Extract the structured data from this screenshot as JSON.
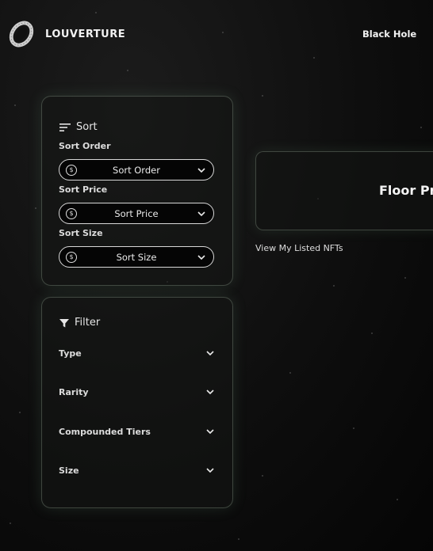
{
  "header": {
    "brand": "LOUVERTURE",
    "nav_link": "Black Hole",
    "logo_icon": "black-hole-ring-logo"
  },
  "sort": {
    "title": "Sort",
    "title_icon": "sort-lines-icon",
    "fields": [
      {
        "label": "Sort Order",
        "value": "Sort Order"
      },
      {
        "label": "Sort Price",
        "value": "Sort Price"
      },
      {
        "label": "Sort Size",
        "value": "Sort Size"
      }
    ],
    "select_icon": "dollar-coin-icon"
  },
  "filter": {
    "title": "Filter",
    "title_icon": "funnel-icon",
    "rows": [
      {
        "label": "Type"
      },
      {
        "label": "Rarity"
      },
      {
        "label": "Compounded Tiers"
      },
      {
        "label": "Size"
      }
    ]
  },
  "floor_card": {
    "title": "Floor Pri"
  },
  "view_listed": "View My Listed NFTs",
  "colors": {
    "background": "#0e0e0e",
    "panel_border": "#8fa896",
    "text": "#e8e8e8"
  }
}
